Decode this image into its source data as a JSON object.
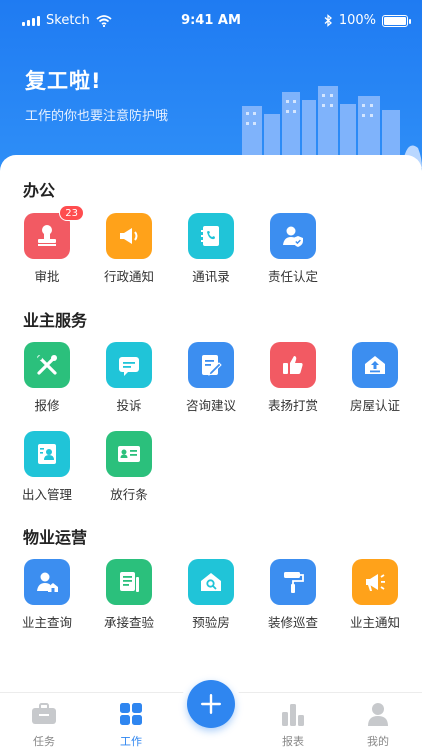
{
  "status_bar": {
    "carrier": "Sketch",
    "time": "9:41 AM",
    "battery": "100%"
  },
  "header": {
    "title": "复工啦!",
    "subtitle": "工作的你也要注意防护哦"
  },
  "sections": [
    {
      "title": "办公",
      "items": [
        {
          "label": "审批",
          "icon": "stamp-icon",
          "color": "#f25a63",
          "badge": "23"
        },
        {
          "label": "行政通知",
          "icon": "megaphone-icon",
          "color": "#ffa21a"
        },
        {
          "label": "通讯录",
          "icon": "contacts-book-icon",
          "color": "#20c4d8"
        },
        {
          "label": "责任认定",
          "icon": "user-shield-icon",
          "color": "#3c8ef0"
        }
      ]
    },
    {
      "title": "业主服务",
      "items": [
        {
          "label": "报修",
          "icon": "tools-icon",
          "color": "#2bc07c"
        },
        {
          "label": "投诉",
          "icon": "message-icon",
          "color": "#20c4d8"
        },
        {
          "label": "咨询建议",
          "icon": "edit-note-icon",
          "color": "#3c8ef0"
        },
        {
          "label": "表扬打赏",
          "icon": "thumbs-up-icon",
          "color": "#f25a63"
        },
        {
          "label": "房屋认证",
          "icon": "house-upload-icon",
          "color": "#3c8ef0"
        },
        {
          "label": "出入管理",
          "icon": "entry-pass-icon",
          "color": "#20c4d8"
        },
        {
          "label": "放行条",
          "icon": "id-card-icon",
          "color": "#2bc07c"
        }
      ]
    },
    {
      "title": "物业运营",
      "items": [
        {
          "label": "业主查询",
          "icon": "owner-search-icon",
          "color": "#3c8ef0"
        },
        {
          "label": "承接查验",
          "icon": "document-check-icon",
          "color": "#2bc07c"
        },
        {
          "label": "预验房",
          "icon": "house-search-icon",
          "color": "#20c4d8"
        },
        {
          "label": "装修巡查",
          "icon": "paint-roller-icon",
          "color": "#3c8ef0"
        },
        {
          "label": "业主通知",
          "icon": "announce-icon",
          "color": "#ffa21a"
        }
      ]
    }
  ],
  "tabbar": {
    "tabs": [
      {
        "label": "任务",
        "icon": "briefcase-icon"
      },
      {
        "label": "工作",
        "icon": "grid-icon",
        "active": true
      },
      {
        "label": "报表",
        "icon": "bar-chart-icon"
      },
      {
        "label": "我的",
        "icon": "person-icon"
      }
    ],
    "center_button_icon": "plus-icon"
  }
}
